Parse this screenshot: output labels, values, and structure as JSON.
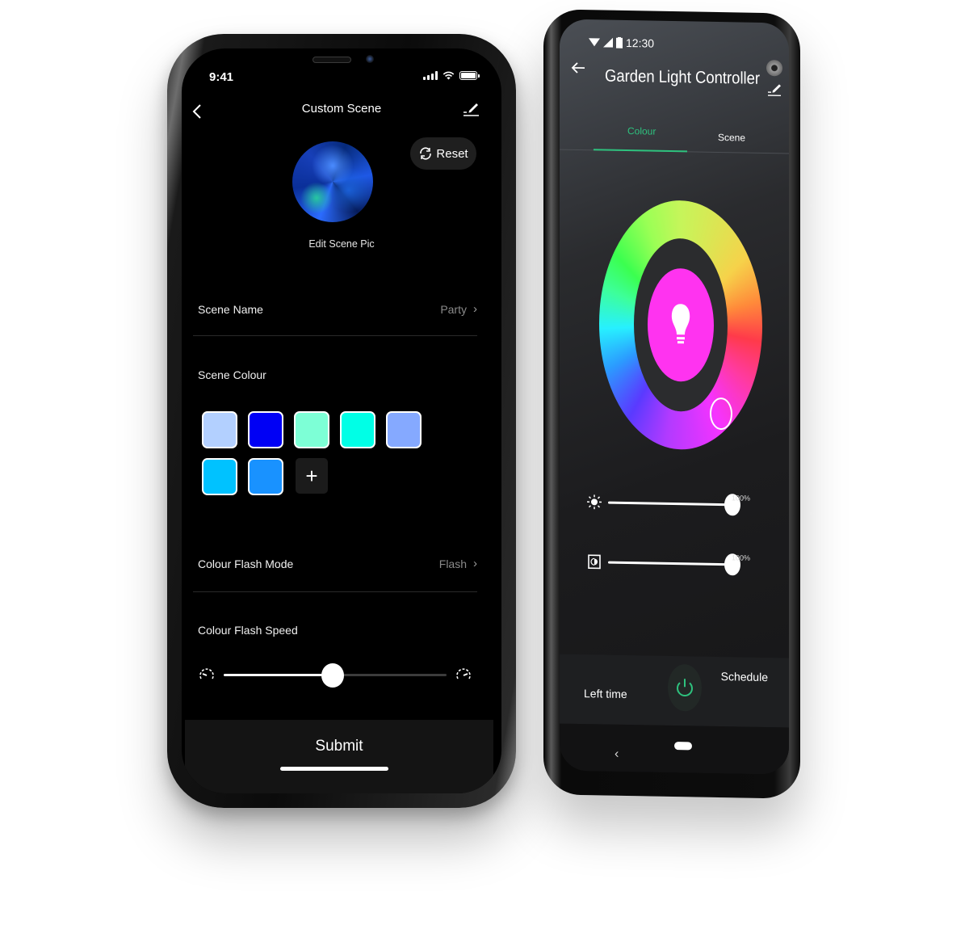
{
  "ios_app": {
    "status_bar": {
      "time": "9:41"
    },
    "header": {
      "title": "Custom Scene",
      "back_icon": "chevron-left-icon",
      "edit_icon": "edit-pencil-icon"
    },
    "scene_pic": {
      "label": "Edit Scene Pic"
    },
    "reset_button": {
      "label": "Reset",
      "icon": "refresh-icon"
    },
    "scene_name": {
      "label": "Scene Name",
      "value": "Party"
    },
    "scene_colour": {
      "label": "Scene Colour",
      "swatches": [
        "#b3d0ff",
        "#0000f5",
        "#7dffd6",
        "#00ffe6",
        "#85a9ff",
        "#00c2ff",
        "#1992ff"
      ],
      "add_label": "+"
    },
    "flash_mode": {
      "label": "Colour Flash Mode",
      "value": "Flash"
    },
    "flash_speed": {
      "label": "Colour Flash Speed",
      "value_percent": 49
    },
    "submit": {
      "label": "Submit"
    }
  },
  "android_app": {
    "status_bar": {
      "time": "12:30"
    },
    "header": {
      "title": "Garden Light Controller"
    },
    "tabs": [
      {
        "label": "Colour",
        "active": true
      },
      {
        "label": "Scene",
        "active": false
      }
    ],
    "colour_wheel": {
      "selected_colour": "#ff33f0"
    },
    "brightness": {
      "value_percent": 100,
      "label": "100%"
    },
    "saturation": {
      "value_percent": 100,
      "label": "100%"
    },
    "bottom_bar": {
      "left_time_label": "Left time",
      "schedule_label": "Schedule",
      "power_state": "on"
    },
    "accent_color": "#2ec27e"
  }
}
